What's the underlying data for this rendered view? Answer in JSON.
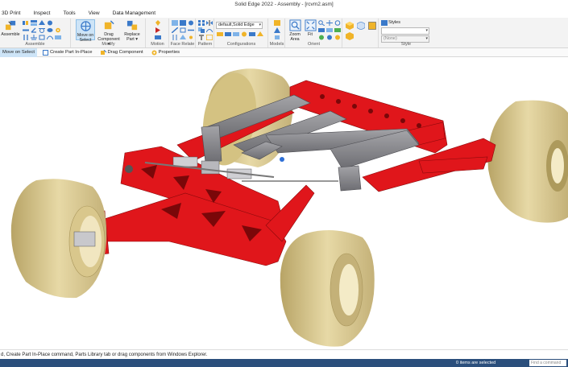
{
  "app": {
    "title": "Solid Edge 2022 - Assembly - [rcvm2.asm]"
  },
  "menu": {
    "tabs": [
      "3D Print",
      "Inspect",
      "Tools",
      "View",
      "Data Management"
    ]
  },
  "ribbon": {
    "assemble": {
      "button": "Assemble",
      "label": "Assemble"
    },
    "modify": {
      "move_line1": "Move on",
      "move_line2": "Select",
      "drag_line1": "Drag",
      "drag_line2": "Component ▾",
      "replace_line1": "Replace",
      "replace_line2": "Part ▾",
      "label": "Modify"
    },
    "motion": {
      "label": "Motion"
    },
    "face_relate": {
      "label": "Face Relate"
    },
    "pattern": {
      "label": "Pattern"
    },
    "configurations": {
      "value": "default,Solid Edge",
      "label": "Configurations"
    },
    "models": {
      "label": "Models"
    },
    "orient": {
      "zoom_line1": "Zoom",
      "zoom_line2": "Area",
      "fit": "Fit",
      "label": "Orient"
    },
    "style": {
      "styles": "Styles",
      "none": "(None)",
      "label": "Style"
    }
  },
  "command_bar": {
    "move_on_select": "Move on Select",
    "create_part": "Create Part In-Place",
    "drag_component": "Drag Component",
    "properties": "Properties"
  },
  "prompt": "d, Create Part In-Place command, Parts Library tab or drag components from Windows Explorer.",
  "status": {
    "selected": "0 items are selected",
    "comment_placeholder": "Find a command"
  },
  "colors": {
    "frame_red": "#e0161b",
    "tire": "#d9c78c",
    "beam_gray": "#8a8a8e",
    "status_blue": "#2b4f7c"
  }
}
